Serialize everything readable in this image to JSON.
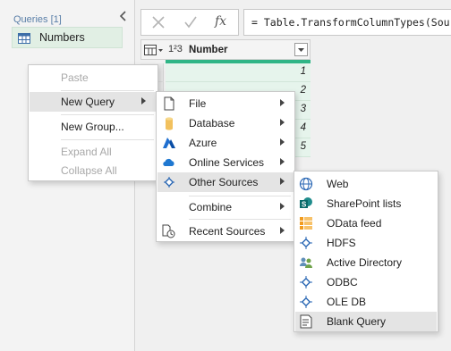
{
  "queries_pane": {
    "header": "Queries [1]",
    "items": [
      {
        "label": "Numbers"
      }
    ]
  },
  "formula_bar": {
    "cancel_icon": "close-icon",
    "commit_icon": "check-icon",
    "fx_label": "fx",
    "text": "= Table.TransformColumnTypes(Source"
  },
  "grid": {
    "type_label": "1²3",
    "column_name": "Number",
    "values": [
      "1",
      "2",
      "3",
      "4",
      "5"
    ],
    "quality_color": "#2fb586"
  },
  "context_menu": {
    "items": [
      {
        "label": "Paste",
        "disabled": true
      },
      {
        "label": "New Query",
        "submenu": true
      },
      {
        "label": "New Group..."
      },
      {
        "label": "Expand All",
        "disabled": true
      },
      {
        "label": "Collapse All",
        "disabled": true
      }
    ]
  },
  "new_query_menu": {
    "items": [
      {
        "label": "File",
        "icon": "file-icon"
      },
      {
        "label": "Database",
        "icon": "database-icon"
      },
      {
        "label": "Azure",
        "icon": "azure-icon"
      },
      {
        "label": "Online Services",
        "icon": "cloud-icon"
      },
      {
        "label": "Other Sources",
        "icon": "other-sources-icon"
      },
      {
        "label": "Combine"
      },
      {
        "label": "Recent Sources",
        "icon": "recent-sources-icon"
      }
    ]
  },
  "other_sources_menu": {
    "items": [
      {
        "label": "Web",
        "icon": "globe-icon"
      },
      {
        "label": "SharePoint lists",
        "icon": "sharepoint-icon"
      },
      {
        "label": "OData feed",
        "icon": "odata-icon"
      },
      {
        "label": "HDFS",
        "icon": "hdfs-icon"
      },
      {
        "label": "Active Directory",
        "icon": "active-directory-icon"
      },
      {
        "label": "ODBC",
        "icon": "odbc-icon"
      },
      {
        "label": "OLE DB",
        "icon": "oledb-icon"
      },
      {
        "label": "Blank Query",
        "icon": "blank-query-icon"
      }
    ]
  }
}
